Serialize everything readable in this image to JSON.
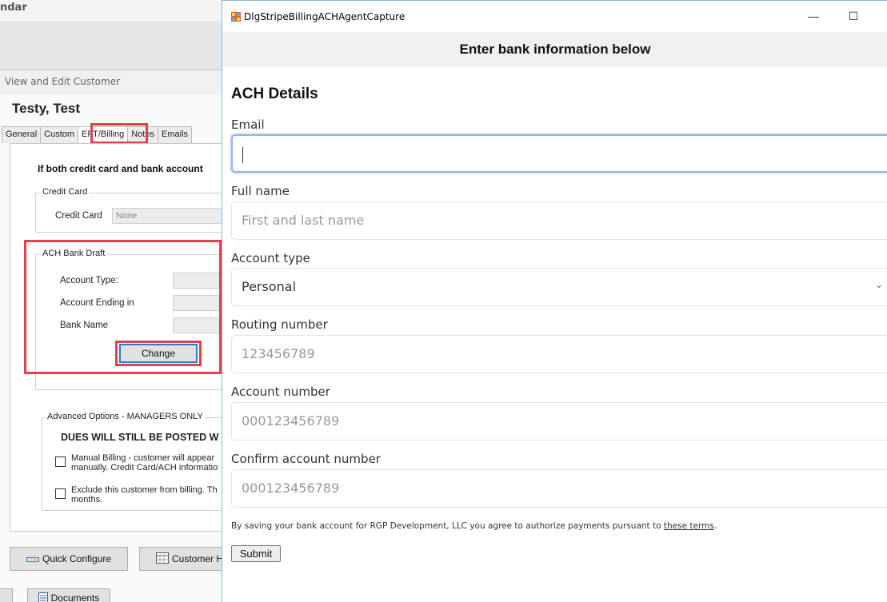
{
  "background": {
    "app_title": "ndar",
    "section_title": "View and Edit Customer",
    "customer_name": "Testy, Test",
    "tabs": [
      "General",
      "Custom",
      "EFT/Billing",
      "Notes",
      "Emails"
    ],
    "active_tab": "EFT/Billing",
    "note": "If both credit card and bank account",
    "credit_card_group": "Credit Card",
    "credit_card_label": "Credit Card",
    "credit_card_value": "None",
    "ach_group": "ACH Bank Draft",
    "account_type_label": "Account Type:",
    "account_ending_label": "Account Ending in",
    "bank_name_label": "Bank Name",
    "change_button": "Change",
    "advanced_group": "Advanced Options - MANAGERS ONLY",
    "dues_warning": "DUES WILL STILL BE POSTED W",
    "manual_billing_line1": "Manual Billing - customer will appear",
    "manual_billing_line2": "manually. Credit Card/ACH informatio",
    "exclude_line1": "Exclude this customer from billing.  Th",
    "exclude_line2": "months.",
    "quick_configure_button": "Quick Configure",
    "customer_h_button": "Customer H",
    "documents_button": "Documents",
    "accent_red": "#e0414a"
  },
  "dialog": {
    "window_title": "DlgStripeBillingACHAgentCapture",
    "minimize_glyph": "—",
    "maximize_glyph": "☐",
    "banner": "Enter bank information below",
    "heading": "ACH Details",
    "fields": {
      "email": {
        "label": "Email",
        "value": "",
        "placeholder": ""
      },
      "full_name": {
        "label": "Full name",
        "placeholder": "First and last name"
      },
      "account_type": {
        "label": "Account type",
        "value": "Personal"
      },
      "routing_number": {
        "label": "Routing number",
        "placeholder": "123456789"
      },
      "account_number": {
        "label": "Account number",
        "placeholder": "000123456789"
      },
      "confirm_account_number": {
        "label": "Confirm account number",
        "placeholder": "000123456789"
      }
    },
    "terms_prefix": "By saving your bank account for RGP Development, LLC you agree to authorize payments pursuant to ",
    "terms_link": "these terms",
    "terms_suffix": ".",
    "submit_button": "Submit",
    "focus_color": "#8fb7e6"
  }
}
